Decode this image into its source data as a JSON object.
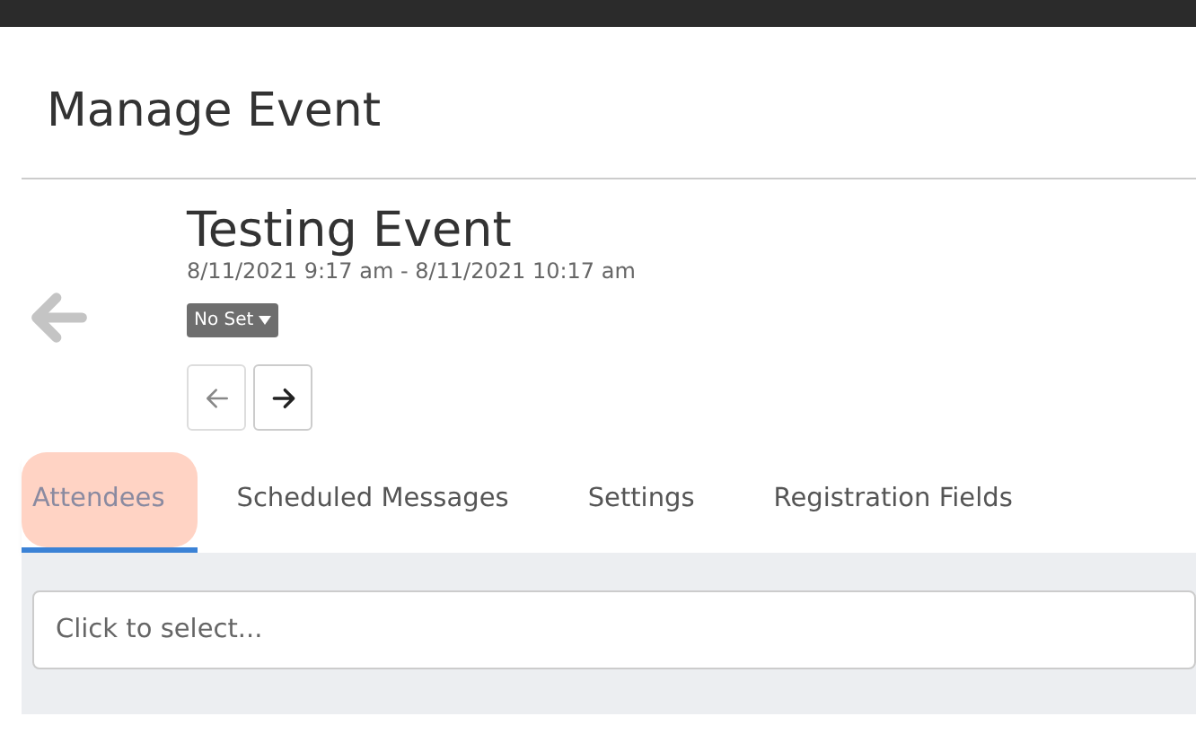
{
  "page_title": "Manage Event",
  "event": {
    "title": "Testing Event",
    "dates": "8/11/2021 9:17 am - 8/11/2021 10:17 am",
    "set_label": "No Set"
  },
  "pager": [
    {
      "kind": "prev",
      "disabled": true
    },
    {
      "kind": "next",
      "disabled": false
    }
  ],
  "tabs": [
    {
      "label": "Attendees",
      "selected": true
    },
    {
      "label": "Scheduled Messages",
      "selected": false
    },
    {
      "label": "Settings",
      "selected": false
    },
    {
      "label": "Registration Fields",
      "selected": false
    }
  ],
  "select": {
    "placeholder": "Click to select..."
  }
}
